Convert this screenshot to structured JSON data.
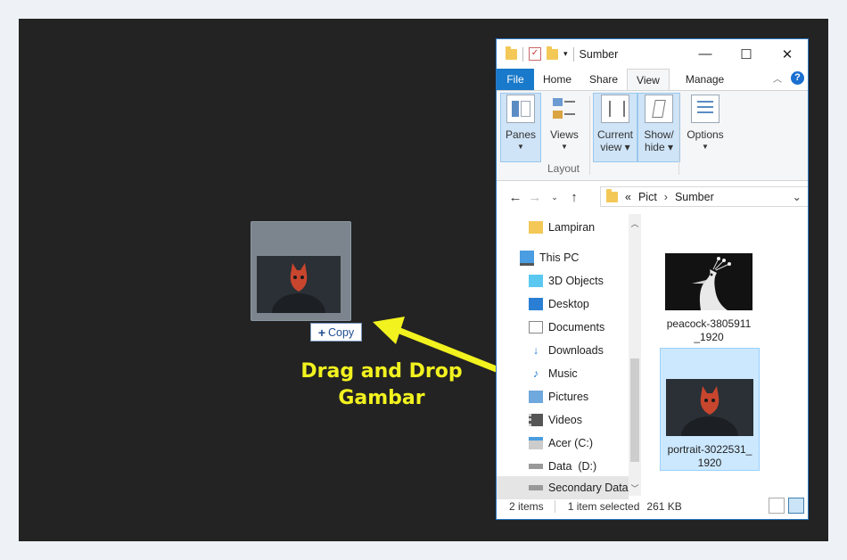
{
  "drag": {
    "copy_label": "Copy"
  },
  "caption": {
    "line1": "Drag and Drop",
    "line2": "Gambar"
  },
  "window": {
    "title": "Sumber",
    "tabs": [
      "File",
      "Home",
      "Share",
      "View",
      "Manage"
    ],
    "ribbon": {
      "panes": "Panes",
      "views": "Views",
      "current_view": [
        "Current",
        "view"
      ],
      "show_hide": [
        "Show/",
        "hide"
      ],
      "options": "Options",
      "group_layout": "Layout"
    },
    "address": {
      "prefix": "«",
      "path": [
        "Pict",
        "Sumber"
      ]
    },
    "nav_items": [
      "Lampiran",
      "This PC",
      "3D Objects",
      "Desktop",
      "Documents",
      "Downloads",
      "Music",
      "Pictures",
      "Videos",
      "Acer (C:)",
      "Data  (D:)",
      "Secondary Data"
    ],
    "files": [
      {
        "name": [
          "peacock-3805911",
          "_1920"
        ]
      },
      {
        "name": [
          "portrait-3022531_",
          "1920"
        ]
      }
    ],
    "status": {
      "items": "2 items",
      "selected": "1 item selected",
      "size": "261 KB"
    }
  },
  "colors": {
    "accent": "#1979ca",
    "caption": "#f2f21f",
    "desktop": "#232323",
    "selection": "#cce8ff"
  }
}
